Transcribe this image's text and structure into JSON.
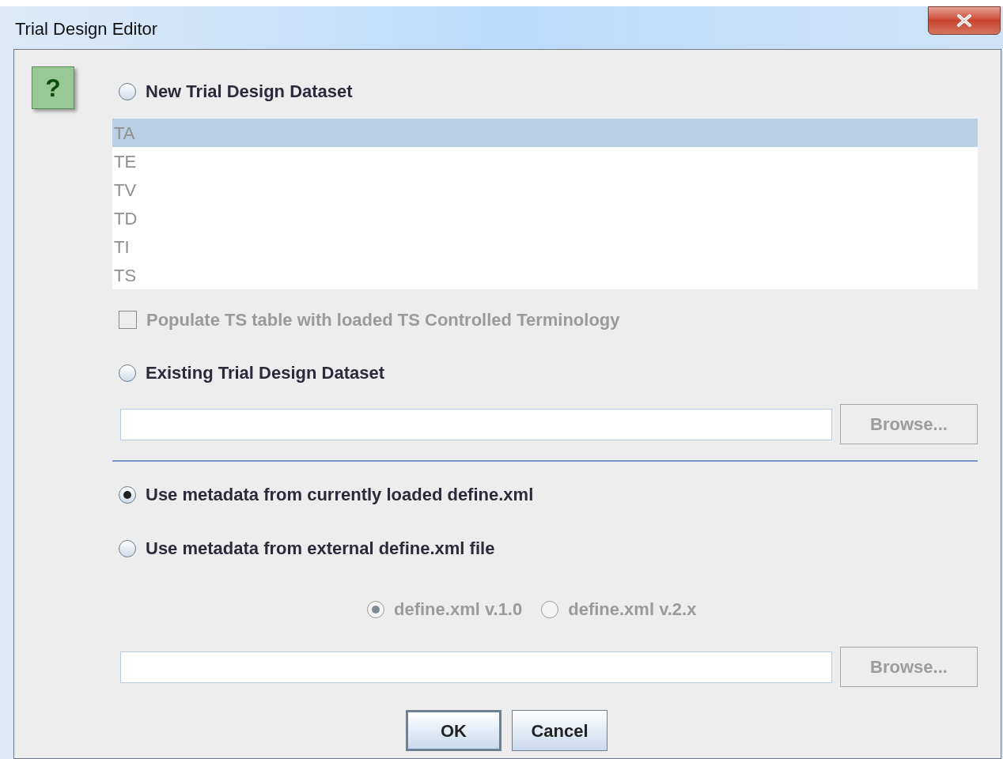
{
  "window": {
    "title": "Trial Design Editor",
    "help": "?"
  },
  "new_dataset": {
    "label": "New Trial Design Dataset",
    "selected": false
  },
  "dataset_list": {
    "disabled": true,
    "items": [
      {
        "label": "TA",
        "selected": true
      },
      {
        "label": "TE",
        "selected": false
      },
      {
        "label": "TV",
        "selected": false
      },
      {
        "label": "TD",
        "selected": false
      },
      {
        "label": "TI",
        "selected": false
      },
      {
        "label": "TS",
        "selected": false
      }
    ]
  },
  "populate_checkbox": {
    "label": "Populate TS table with loaded TS Controlled Terminology",
    "checked": false,
    "disabled": true
  },
  "existing_dataset": {
    "label": "Existing Trial Design Dataset",
    "selected": false
  },
  "existing_path": {
    "browse": "Browse...",
    "disabled": true
  },
  "metadata_options": [
    {
      "label": "Use metadata from currently loaded define.xml",
      "selected": true
    },
    {
      "label": "Use metadata from external define.xml file",
      "selected": false
    }
  ],
  "define_versions": {
    "disabled": true,
    "options": [
      {
        "label": "define.xml v.1.0",
        "selected": true
      },
      {
        "label": "define.xml v.2.x",
        "selected": false
      }
    ]
  },
  "external_path": {
    "browse": "Browse...",
    "disabled": true
  },
  "buttons": [
    {
      "label": "OK",
      "default": true
    },
    {
      "label": "Cancel",
      "default": false
    }
  ]
}
